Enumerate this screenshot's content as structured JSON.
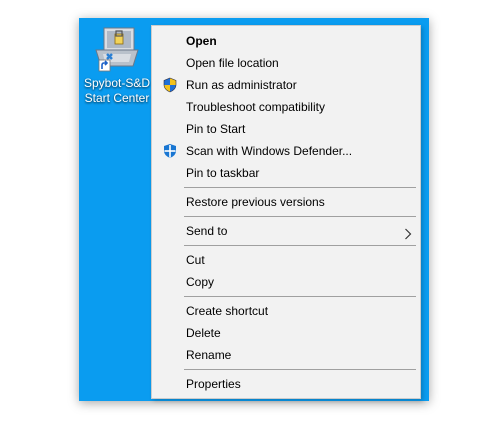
{
  "desktop": {
    "background": "#0a9cf0",
    "shortcut": {
      "label_line1": "Spybot-S&D",
      "label_line2": "Start Center",
      "icon": "spybot-shortcut-icon"
    }
  },
  "context_menu": {
    "items": [
      {
        "label": "Open",
        "bold": true
      },
      {
        "label": "Open file location"
      },
      {
        "label": "Run as administrator",
        "icon": "uac-shield-icon"
      },
      {
        "label": "Troubleshoot compatibility"
      },
      {
        "label": "Pin to Start"
      },
      {
        "label": "Scan with Windows Defender...",
        "icon": "windows-defender-icon"
      },
      {
        "label": "Pin to taskbar"
      },
      {
        "label": "Restore previous versions"
      },
      {
        "label": "Send to",
        "submenu": true
      },
      {
        "label": "Cut"
      },
      {
        "label": "Copy"
      },
      {
        "label": "Create shortcut"
      },
      {
        "label": "Delete"
      },
      {
        "label": "Rename"
      },
      {
        "label": "Properties"
      }
    ]
  }
}
